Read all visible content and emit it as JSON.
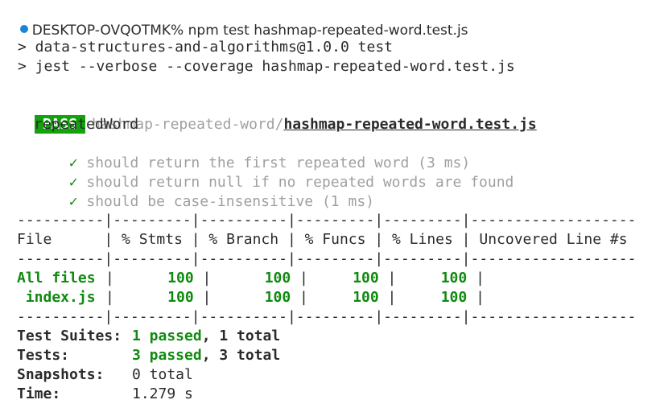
{
  "terminal": {
    "prompt": {
      "host": "DESKTOP-OVQOTMK%",
      "command": "npm test hashmap-repeated-word.test.js"
    },
    "npm_output": [
      "> data-structures-and-algorithms@1.0.0 test",
      "> jest --verbose --coverage hashmap-repeated-word.test.js"
    ],
    "result": {
      "badge": "PASS",
      "path_dir": "hashmap-repeated-word/",
      "path_file": "hashmap-repeated-word.test.js",
      "suite_name": "repeatedWord",
      "check_glyph": "✓",
      "tests": [
        "should return the first repeated word (3 ms)",
        "should return null if no repeated words are found",
        "should be case-insensitive (1 ms)"
      ]
    },
    "coverage": {
      "rule": "----------|---------|----------|---------|---------|-------------------",
      "header": "File      | % Stmts | % Branch | % Funcs | % Lines | Uncovered Line #s ",
      "rows": [
        {
          "file": "All files",
          "stmts": "100",
          "branch": "100",
          "funcs": "100",
          "lines": "100",
          "uncovered": ""
        },
        {
          "file": " index.js",
          "stmts": "100",
          "branch": "100",
          "funcs": "100",
          "lines": "100",
          "uncovered": ""
        }
      ]
    },
    "summary": {
      "suites_label": "Test Suites:",
      "suites_passed": "1 passed",
      "suites_total": ", 1 total",
      "tests_label": "Tests:",
      "tests_passed": "3 passed",
      "tests_total": ", 3 total",
      "snapshots_label": "Snapshots:",
      "snapshots_value": "0 total",
      "time_label": "Time:",
      "time_value": "1.279 s"
    }
  },
  "colors": {
    "pass_badge": "#13a10e",
    "green_text": "#108a10",
    "dim_text": "#a0a0a0",
    "prompt_dot": "#1a85d6"
  }
}
